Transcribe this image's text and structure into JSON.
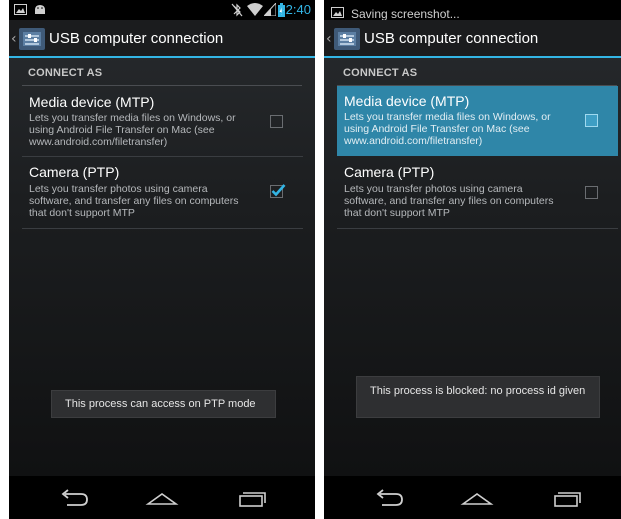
{
  "left": {
    "status_bar": {
      "time": "12:40",
      "icons": [
        "screenshot-icon",
        "android-icon",
        "bluetooth-off-icon",
        "wifi-icon",
        "signal-icon",
        "battery-charging-icon"
      ]
    },
    "action_bar": {
      "title": "USB computer connection",
      "icon": "usb-settings-icon"
    },
    "section_header": "CONNECT AS",
    "options": [
      {
        "title": "Media device (MTP)",
        "summary": "Lets you transfer media files on Windows, or using Android File Transfer on Mac (see www.android.com/filetransfer)",
        "checked": false
      },
      {
        "title": "Camera (PTP)",
        "summary": "Lets you transfer photos using camera software, and transfer any files on computers that don't support MTP",
        "checked": true
      }
    ],
    "toast": "This process can access on PTP mode",
    "nav": [
      "back-icon",
      "home-icon",
      "recent-apps-icon"
    ]
  },
  "right": {
    "status_bar": {
      "notification": "Saving screenshot...",
      "icons": [
        "screenshot-icon"
      ]
    },
    "action_bar": {
      "title": "USB computer connection",
      "icon": "usb-settings-icon"
    },
    "section_header": "CONNECT AS",
    "options": [
      {
        "title": "Media device (MTP)",
        "summary": "Lets you transfer media files on Windows, or using Android File Transfer on Mac (see www.android.com/filetransfer)",
        "checked": false,
        "pressed": true
      },
      {
        "title": "Camera (PTP)",
        "summary": "Lets you transfer photos using camera software, and transfer any files on computers that don't support MTP",
        "checked": false
      }
    ],
    "toast": "This process is blocked: no process id given",
    "nav": [
      "back-icon",
      "home-icon",
      "recent-apps-icon"
    ]
  },
  "colors": {
    "accent": "#33b5e5",
    "pressed_highlight": "#2f86a8",
    "background": "#1c1e20"
  }
}
